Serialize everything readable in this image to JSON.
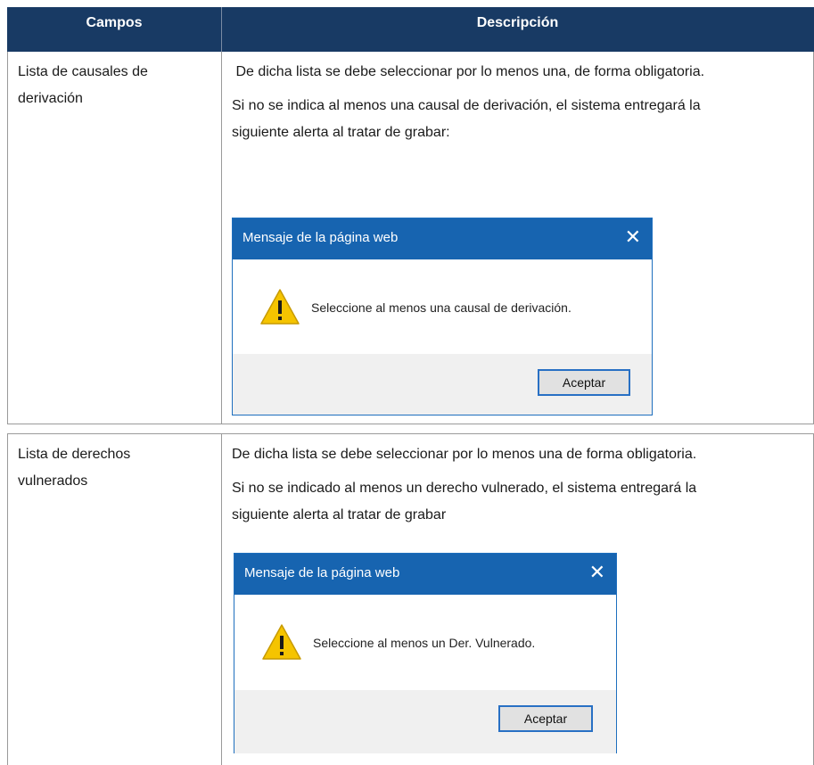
{
  "table": {
    "headers": {
      "campos": "Campos",
      "descripcion": "Descripción"
    },
    "rows": [
      {
        "field_label": "Lista de causales de derivación",
        "field_line1": "Lista de causales de",
        "field_line2": "derivación",
        "desc_line1": " De dicha lista se debe seleccionar por lo menos una, de forma obligatoria.",
        "desc_line2": "Si no se indica al menos una causal de derivación, el sistema entregará la",
        "desc_line3": "siguiente alerta al tratar de grabar:",
        "dialog": {
          "title": "Mensaje de la página web",
          "close_glyph": "✕",
          "icon": "warning-triangle-icon",
          "message": "Seleccione al menos una causal de derivación.",
          "button": "Aceptar"
        }
      },
      {
        "field_line1": "Lista de derechos",
        "field_line2": "vulnerados",
        "desc_line1": "De dicha lista se debe seleccionar por lo menos una de forma obligatoria.",
        "desc_line2": "Si no se indicado al menos un derecho vulnerado, el sistema entregará la",
        "desc_line3": "siguiente alerta al tratar de grabar",
        "dialog": {
          "title": "Mensaje de la página web",
          "close_glyph": "✕",
          "icon": "warning-triangle-icon",
          "message": "Seleccione al menos un Der. Vulnerado.",
          "button": "Aceptar"
        }
      }
    ]
  },
  "colors": {
    "header_bg": "#183a64",
    "dialog_titlebar": "#1764b0",
    "warning_yellow": "#f5c400"
  }
}
